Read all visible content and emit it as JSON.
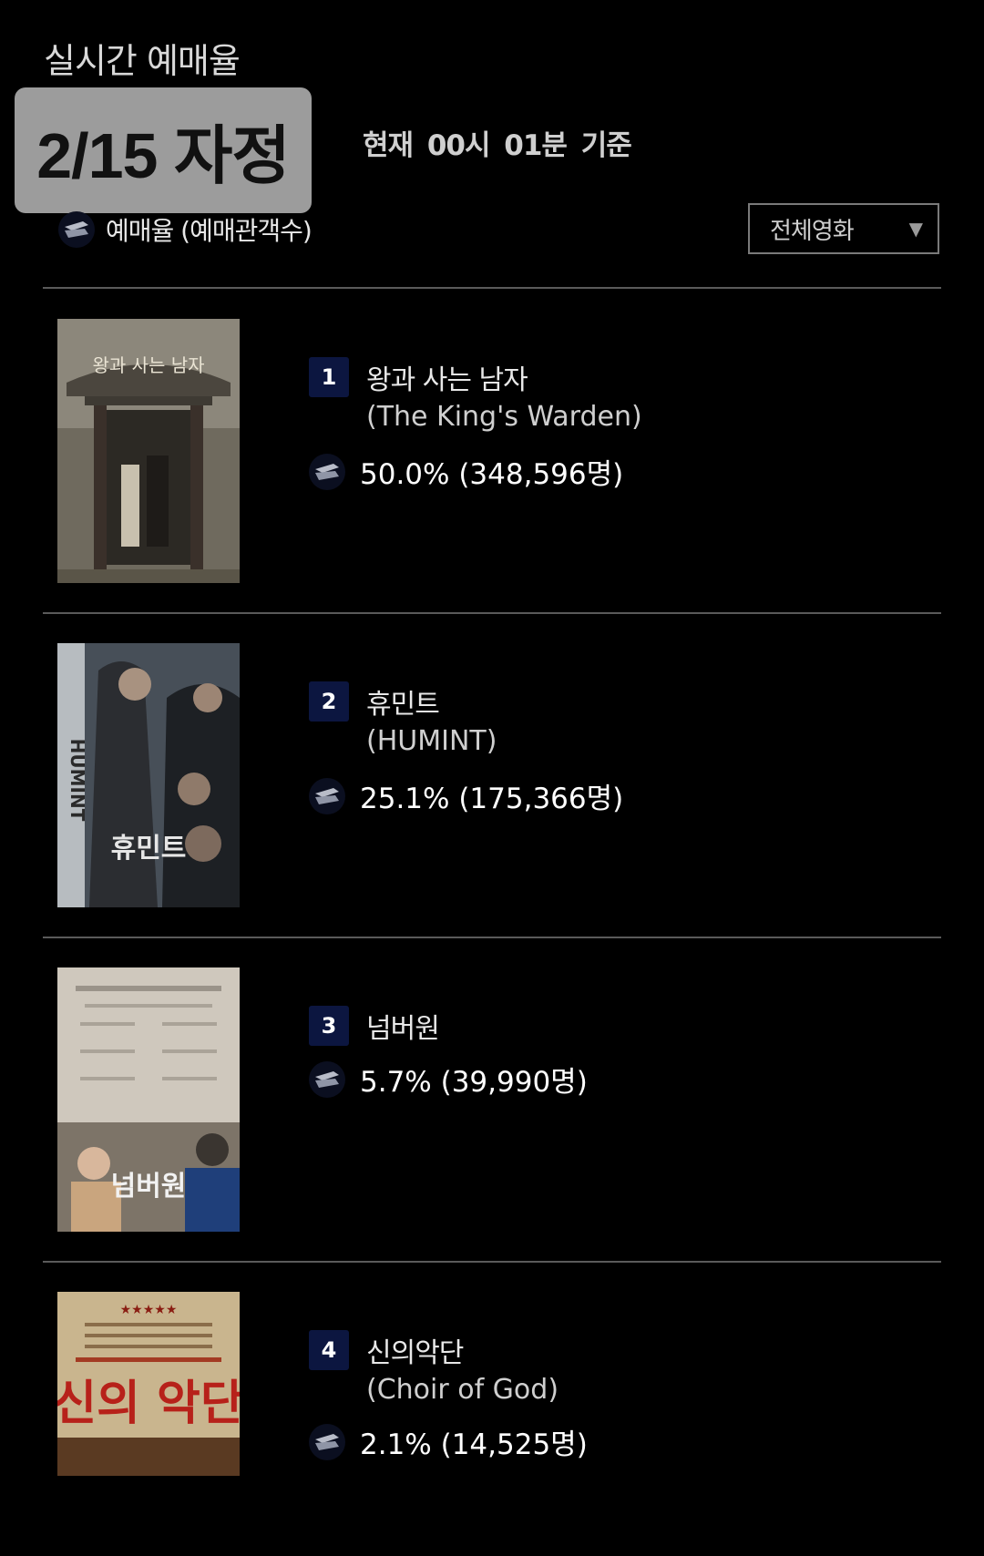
{
  "header": {
    "title": "실시간 예매율",
    "date_badge": "2/15 자정",
    "time_basis": "현재  00시 01분  기준"
  },
  "legend": {
    "icon": "ticket-icon",
    "label": "예매율 (예매관객수)"
  },
  "filter": {
    "selected": "전체영화",
    "arrow": "▼"
  },
  "movies": [
    {
      "rank": "1",
      "title": "왕과 사는 남자",
      "english_title": "(The King's Warden)",
      "rate": "50.0% (348,596명)",
      "poster_text": "왕과 사는 남자"
    },
    {
      "rank": "2",
      "title": "휴민트",
      "english_title": "(HUMINT)",
      "rate": "25.1% (175,366명)",
      "poster_text": "휴민트",
      "poster_side_text": "HUMINT"
    },
    {
      "rank": "3",
      "title": "넘버원",
      "english_title": "",
      "rate": "5.7% (39,990명)",
      "poster_text": "넘버원"
    },
    {
      "rank": "4",
      "title": "신의악단",
      "english_title": "(Choir of God)",
      "rate": "2.1% (14,525명)",
      "poster_text": "신의 악단",
      "poster_stars": "★★★★★"
    }
  ],
  "colors": {
    "background": "#000000",
    "rank_badge": "#0c1640",
    "divider": "#5a5a5a",
    "date_badge": "#9c9c9c"
  }
}
